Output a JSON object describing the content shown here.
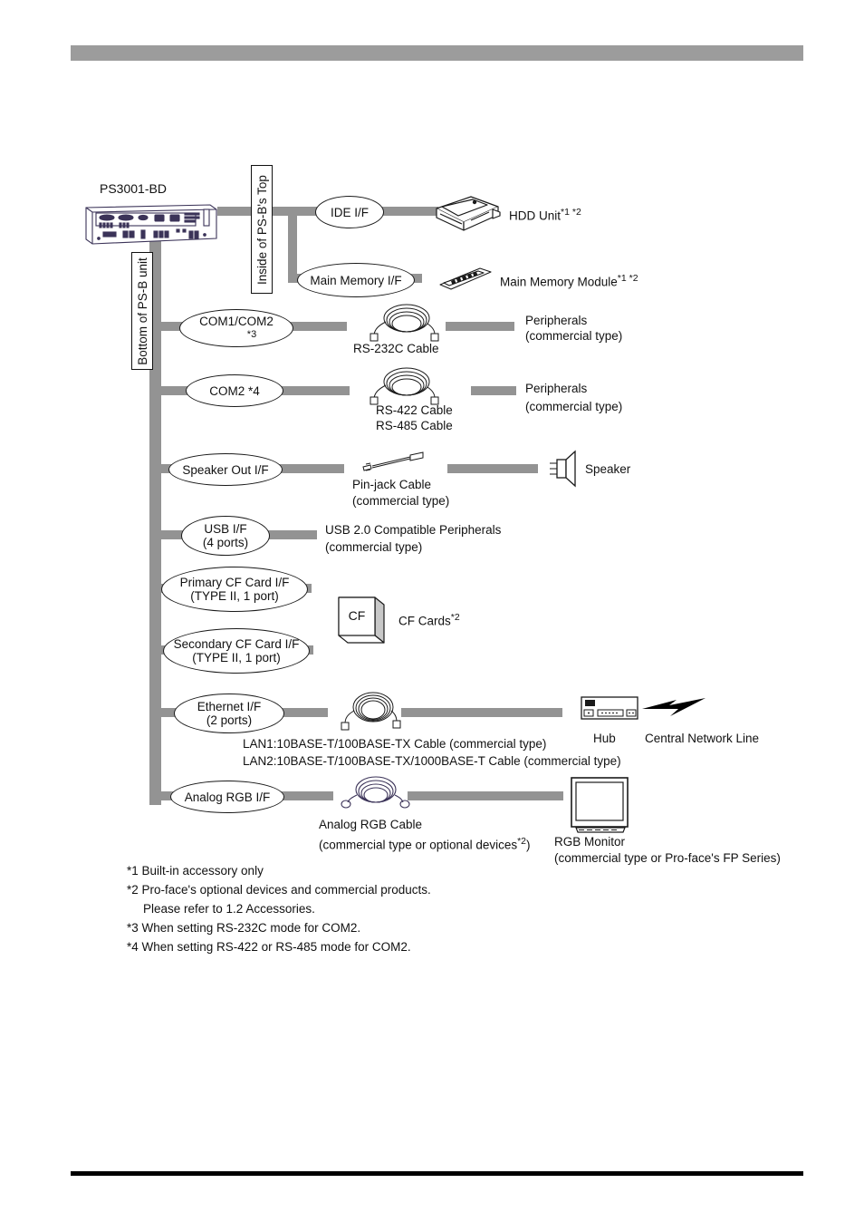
{
  "page": {
    "device_label": "PS3001-BD",
    "vertical_labels": {
      "top": "Inside of PS-B's Top",
      "bottom": "Bottom of PS-B unit"
    }
  },
  "nodes": [
    {
      "id": "ide",
      "lines": [
        "IDE I/F"
      ]
    },
    {
      "id": "mainmem",
      "lines": [
        "Main Memory I/F"
      ]
    },
    {
      "id": "com1com2",
      "lines": [
        "COM1/COM2",
        "*3"
      ]
    },
    {
      "id": "com2",
      "lines": [
        "COM2  *4"
      ]
    },
    {
      "id": "speakerout",
      "lines": [
        "Speaker Out I/F"
      ]
    },
    {
      "id": "usb",
      "lines": [
        "USB I/F",
        "(4 ports)"
      ]
    },
    {
      "id": "cfprimary",
      "lines": [
        "Primary CF Card I/F",
        "(TYPE II, 1 port)"
      ]
    },
    {
      "id": "cfsecondary",
      "lines": [
        "Secondary CF Card I/F",
        "(TYPE II, 1 port)"
      ]
    },
    {
      "id": "ethernet",
      "lines": [
        "Ethernet I/F",
        "(2 ports)"
      ]
    },
    {
      "id": "rgb",
      "lines": [
        "Analog RGB I/F"
      ]
    }
  ],
  "labels": {
    "hdd_unit": "HDD Unit",
    "hdd_unit_sup": "*1 *2",
    "main_memory_module": "Main Memory Module",
    "main_memory_module_sup": "*1 *2",
    "rs232c_cable": "RS-232C Cable",
    "peripherals_1_line1": "Peripherals",
    "peripherals_1_line2": "(commercial type)",
    "rs422_cable": "RS-422 Cable",
    "rs485_cable": "RS-485 Cable",
    "peripherals_2_line1": "Peripherals",
    "peripherals_2_line2": "(commercial type)",
    "pinjack_cable_line1": "Pin-jack Cable",
    "pinjack_cable_line2": "(commercial type)",
    "speaker": "Speaker",
    "usb_peripherals_line1": "USB 2.0 Compatible Peripherals",
    "usb_peripherals_line2": "(commercial type)",
    "cf_card_glyph": "CF",
    "cf_cards": "CF Cards",
    "cf_cards_sup": "*2",
    "lan1_cable": "LAN1:10BASE-T/100BASE-TX Cable (commercial type)",
    "lan2_cable": "LAN2:10BASE-T/100BASE-TX/1000BASE-T Cable (commercial type)",
    "hub": "Hub",
    "central_network_line": "Central Network Line",
    "analog_rgb_cable_line1": "Analog RGB Cable",
    "analog_rgb_cable_line2_a": "(commercial type or optional devices",
    "analog_rgb_cable_line2_sup": "*2",
    "analog_rgb_cable_line2_b": ")",
    "rgb_monitor_line1": "RGB Monitor",
    "rgb_monitor_line2": "(commercial type or Pro-face's FP Series)"
  },
  "notes": [
    "*1 Built-in accessory only",
    "*2 Pro-face's optional devices and commercial products.",
    "Please refer to 1.2 Accessories.",
    "*3 When setting RS-232C mode for COM2.",
    "*4 When setting RS-422 or RS-485 mode for COM2."
  ],
  "colors": {
    "connector_gray": "#939393",
    "header_gray": "#9c9c9c",
    "device_ink": "#3b3358",
    "text": "#111111",
    "footer_black": "#000000"
  }
}
